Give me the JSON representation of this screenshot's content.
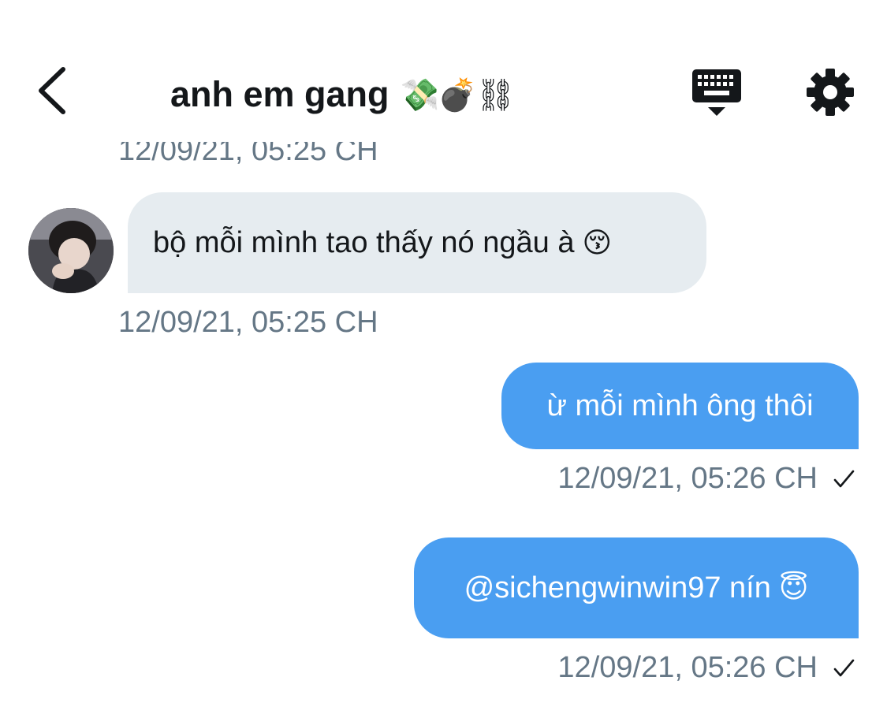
{
  "header": {
    "title": "anh em gang",
    "title_emoji": "💸💣⛓",
    "back_icon": "chevron-left-icon",
    "keyboard_icon": "keyboard-icon",
    "settings_icon": "gear-icon"
  },
  "messages": [
    {
      "direction": "incoming",
      "text": "bộ mỗi mình tao thấy nó ngầu à",
      "emoji": "😚",
      "timestamp": "12/09/21, 05:25 CH"
    },
    {
      "direction": "outgoing",
      "text": "ừ mỗi mình ông thôi",
      "emoji": "",
      "timestamp": "12/09/21, 05:26 CH",
      "status": "✓"
    },
    {
      "direction": "outgoing",
      "text": "@sichengwinwin97 nín",
      "emoji": "😇",
      "timestamp": "12/09/21, 05:26 CH",
      "status": "✓"
    }
  ],
  "previous_timestamp": "12/09/21, 05:25 CH",
  "colors": {
    "outgoing_bubble": "#4a9ef1",
    "incoming_bubble": "#e6ecf0",
    "timestamp": "#657786",
    "text": "#14171a"
  }
}
